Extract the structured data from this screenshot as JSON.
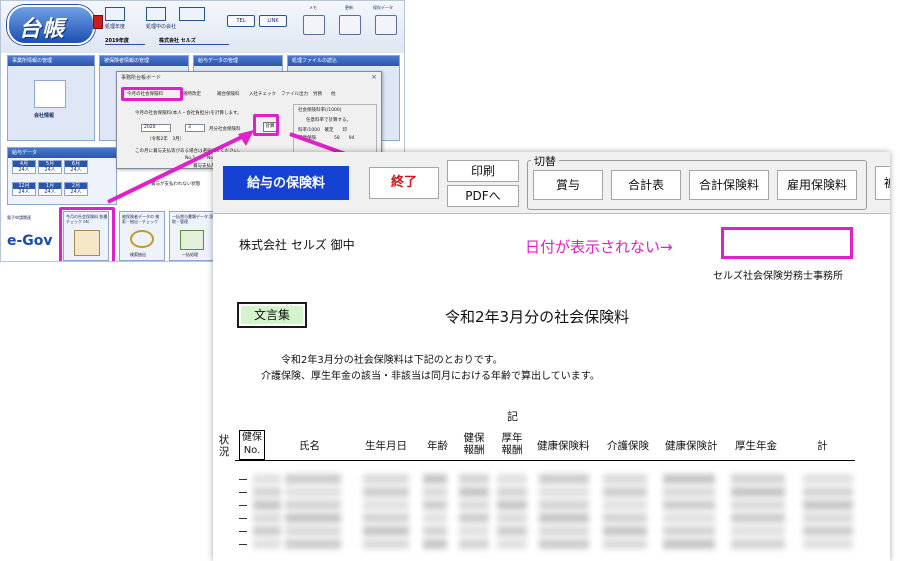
{
  "app": {
    "logo_text": "台帳",
    "header_labels": {
      "nendo_label": "処理年度",
      "nendo_value": "2019年度",
      "company_label": "処理中の会社",
      "company_value": "株式会社 セルズ",
      "tel": "TEL",
      "link": "LINK",
      "memo": "メモ",
      "update": "更新",
      "data_save": "保存データ"
    },
    "panels": [
      {
        "title": "事業所情報の管理",
        "label": "会社情報"
      },
      {
        "title": "被保険者情報の管理",
        "label": ""
      },
      {
        "title": "給与データの管理",
        "label": ""
      },
      {
        "title": "処理ファイルの読込",
        "label": ""
      }
    ],
    "kyuyo_data": {
      "title": "給与データ",
      "months_row1": [
        "4月",
        "5月",
        "6月"
      ],
      "months_row2": [
        "12月",
        "1月",
        "2月"
      ],
      "count": "24人"
    },
    "bottom": {
      "denshi_label": "電子申請関連",
      "egov": "e-Gov",
      "tile1_label": "今月の社会保険料 各種チェック etc",
      "tile2_label": "被保険者データの 検索・抽出・チェック",
      "tile3_label": "一括賞与書類データ 読取・管理",
      "tile2_btn": "検索抽出",
      "tile3_btn": "一括処理"
    },
    "dialog": {
      "title": "事務所台帳ボード",
      "close": "×",
      "tabs": [
        "今月の社会保険料",
        "随時改定",
        "補合保険料",
        "入社チェック",
        "ファイル出力",
        "労務",
        "他"
      ],
      "desc": "今月の社会保険料(本人・会社負担分)を計算します。",
      "year": "2020",
      "month": "3",
      "month_note": "月分社会保険料",
      "wareki": "（令和2年　3月）",
      "calc": "計算",
      "section_title": "この月に賞与支払等がある場合は選択してください。",
      "opt1": "No.1",
      "opt2": "No",
      "opt_note": "賞与支払月 月",
      "check_label": "賞与が支払われない状態",
      "right_title": "社会保険料率(/1000)",
      "right_check": "任意料率で計算する。",
      "right_rate": "料率/1000　確定　　印",
      "right_kenpo": "健康保険　　　　58　　94"
    }
  },
  "report": {
    "toolbar": {
      "kyuyo": "給与の保険料",
      "end": "終了",
      "print": "印刷",
      "pdf": "PDFへ",
      "switch_label": "切替",
      "switch_buttons": [
        "賞与",
        "合計表",
        "合計保険料",
        "雇用保険料"
      ],
      "more": "被"
    },
    "company": "株式会社 セルズ 御中",
    "date_note": "日付が表示されない→",
    "office": "セルズ社会保険労務士事務所",
    "bunsho": "文言集",
    "title": "令和2年3月分の社会保険料",
    "line1": "令和2年3月分の社会保険料は下記のとおりです。",
    "line2": "介護保険、厚生年金の該当・非該当は同月における年齢で算出しています。",
    "ki": "記",
    "headers": {
      "status": "状況",
      "no": "健保No.",
      "name": "氏名",
      "birth": "生年月日",
      "age": "年齢",
      "kenpo_hoshu": "健保報酬",
      "kounen_hoshu": "厚年報酬",
      "kenpo_ryo": "健康保険料",
      "kaigo": "介護保険",
      "kenpo_kei": "健康保険計",
      "kousei": "厚生年金",
      "total": "計"
    }
  },
  "colors": {
    "highlight": "#e020c8",
    "primary_button": "#1642d4",
    "end_text": "#d41515",
    "bunsho_bg": "#d4f5cc"
  }
}
